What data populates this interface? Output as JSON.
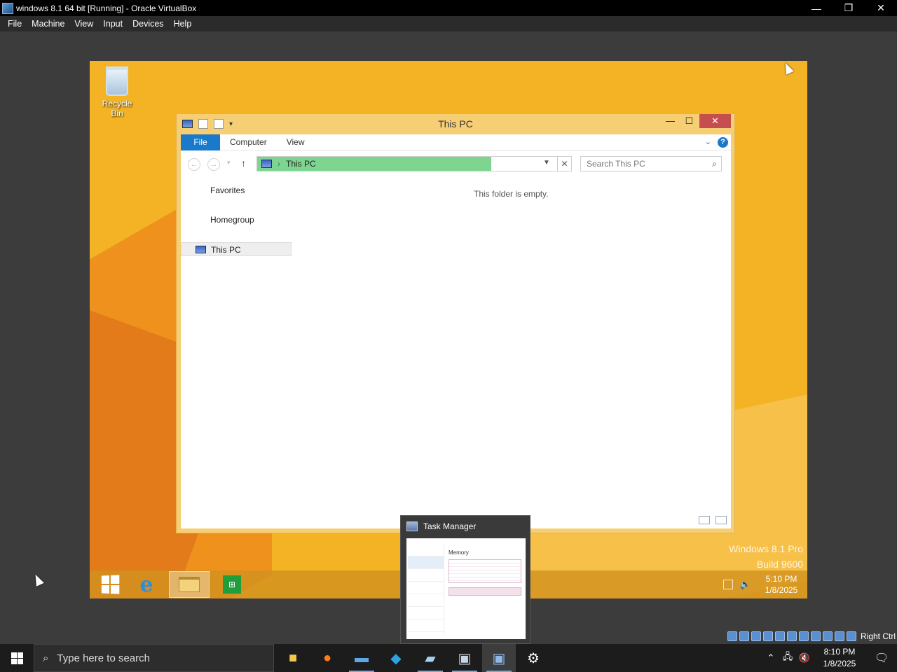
{
  "host": {
    "title": "windows 8.1 64 bit [Running] - Oracle VirtualBox",
    "controls": {
      "minimize": "—",
      "restore": "❐",
      "close": "✕"
    },
    "menu": [
      "File",
      "Machine",
      "View",
      "Input",
      "Devices",
      "Help"
    ],
    "hostkey": "Right Ctrl",
    "taskbar": {
      "search_placeholder": "Type here to search",
      "apps": [
        "File Explorer",
        "Firefox",
        "Remote Desktop",
        "Visual Studio",
        "Notepad",
        "VirtualBox Manager",
        "VirtualBox VM",
        "Settings"
      ],
      "time": "8:10 PM",
      "date": "1/8/2025"
    }
  },
  "guest": {
    "desktop": {
      "recycle_bin": "Recycle Bin",
      "watermark_line1": "Windows 8.1 Pro",
      "watermark_line2": "Build 9600"
    },
    "explorer": {
      "title": "This PC",
      "controls": {
        "minimize": "—",
        "maximize": "☐",
        "close": "✕"
      },
      "ribbon_tabs": {
        "file": "File",
        "computer": "Computer",
        "view": "View"
      },
      "help": "?",
      "address": "This PC",
      "search_placeholder": "Search This PC",
      "nav": {
        "favorites": "Favorites",
        "homegroup": "Homegroup",
        "thispc": "This PC"
      },
      "empty_message": "This folder is empty."
    },
    "taskbar": {
      "time": "5:10 PM",
      "date": "1/8/2025"
    },
    "thumbnail": {
      "title": "Task Manager",
      "section": "Memory"
    }
  },
  "colors": {
    "desktop_bg": "#f4b324",
    "explorer_frame": "#f6ce74",
    "file_tab": "#1979ca",
    "address_highlight": "#7dd590",
    "close_button": "#c74e4f"
  }
}
